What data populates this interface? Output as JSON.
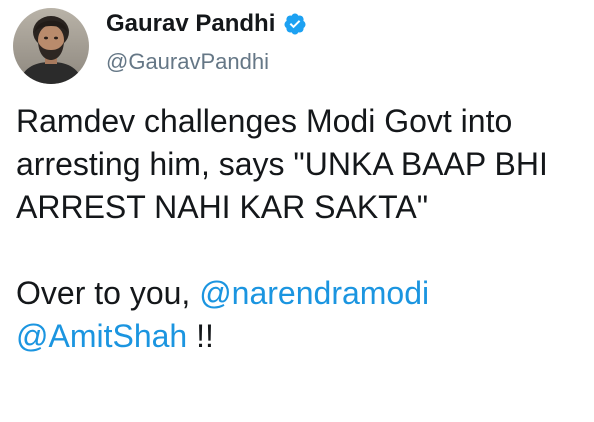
{
  "author": {
    "name": "Gaurav Pandhi",
    "handle": "@GauravPandhi",
    "verified": true,
    "avatar_icon": "profile-photo"
  },
  "tweet": {
    "paragraph1": "Ramdev challenges Modi Govt into arresting him, says \"UNKA BAAP BHI ARREST NAHI KAR SAKTA\"",
    "paragraph2": {
      "lead": "Over to you, ",
      "mention1": "@narendramodi",
      "mention2": "@AmitShah",
      "tail": " !!"
    }
  },
  "colors": {
    "text": "#14171a",
    "secondary_text": "#657786",
    "link": "#1b95e0",
    "verified_badge": "#1da1f2"
  }
}
